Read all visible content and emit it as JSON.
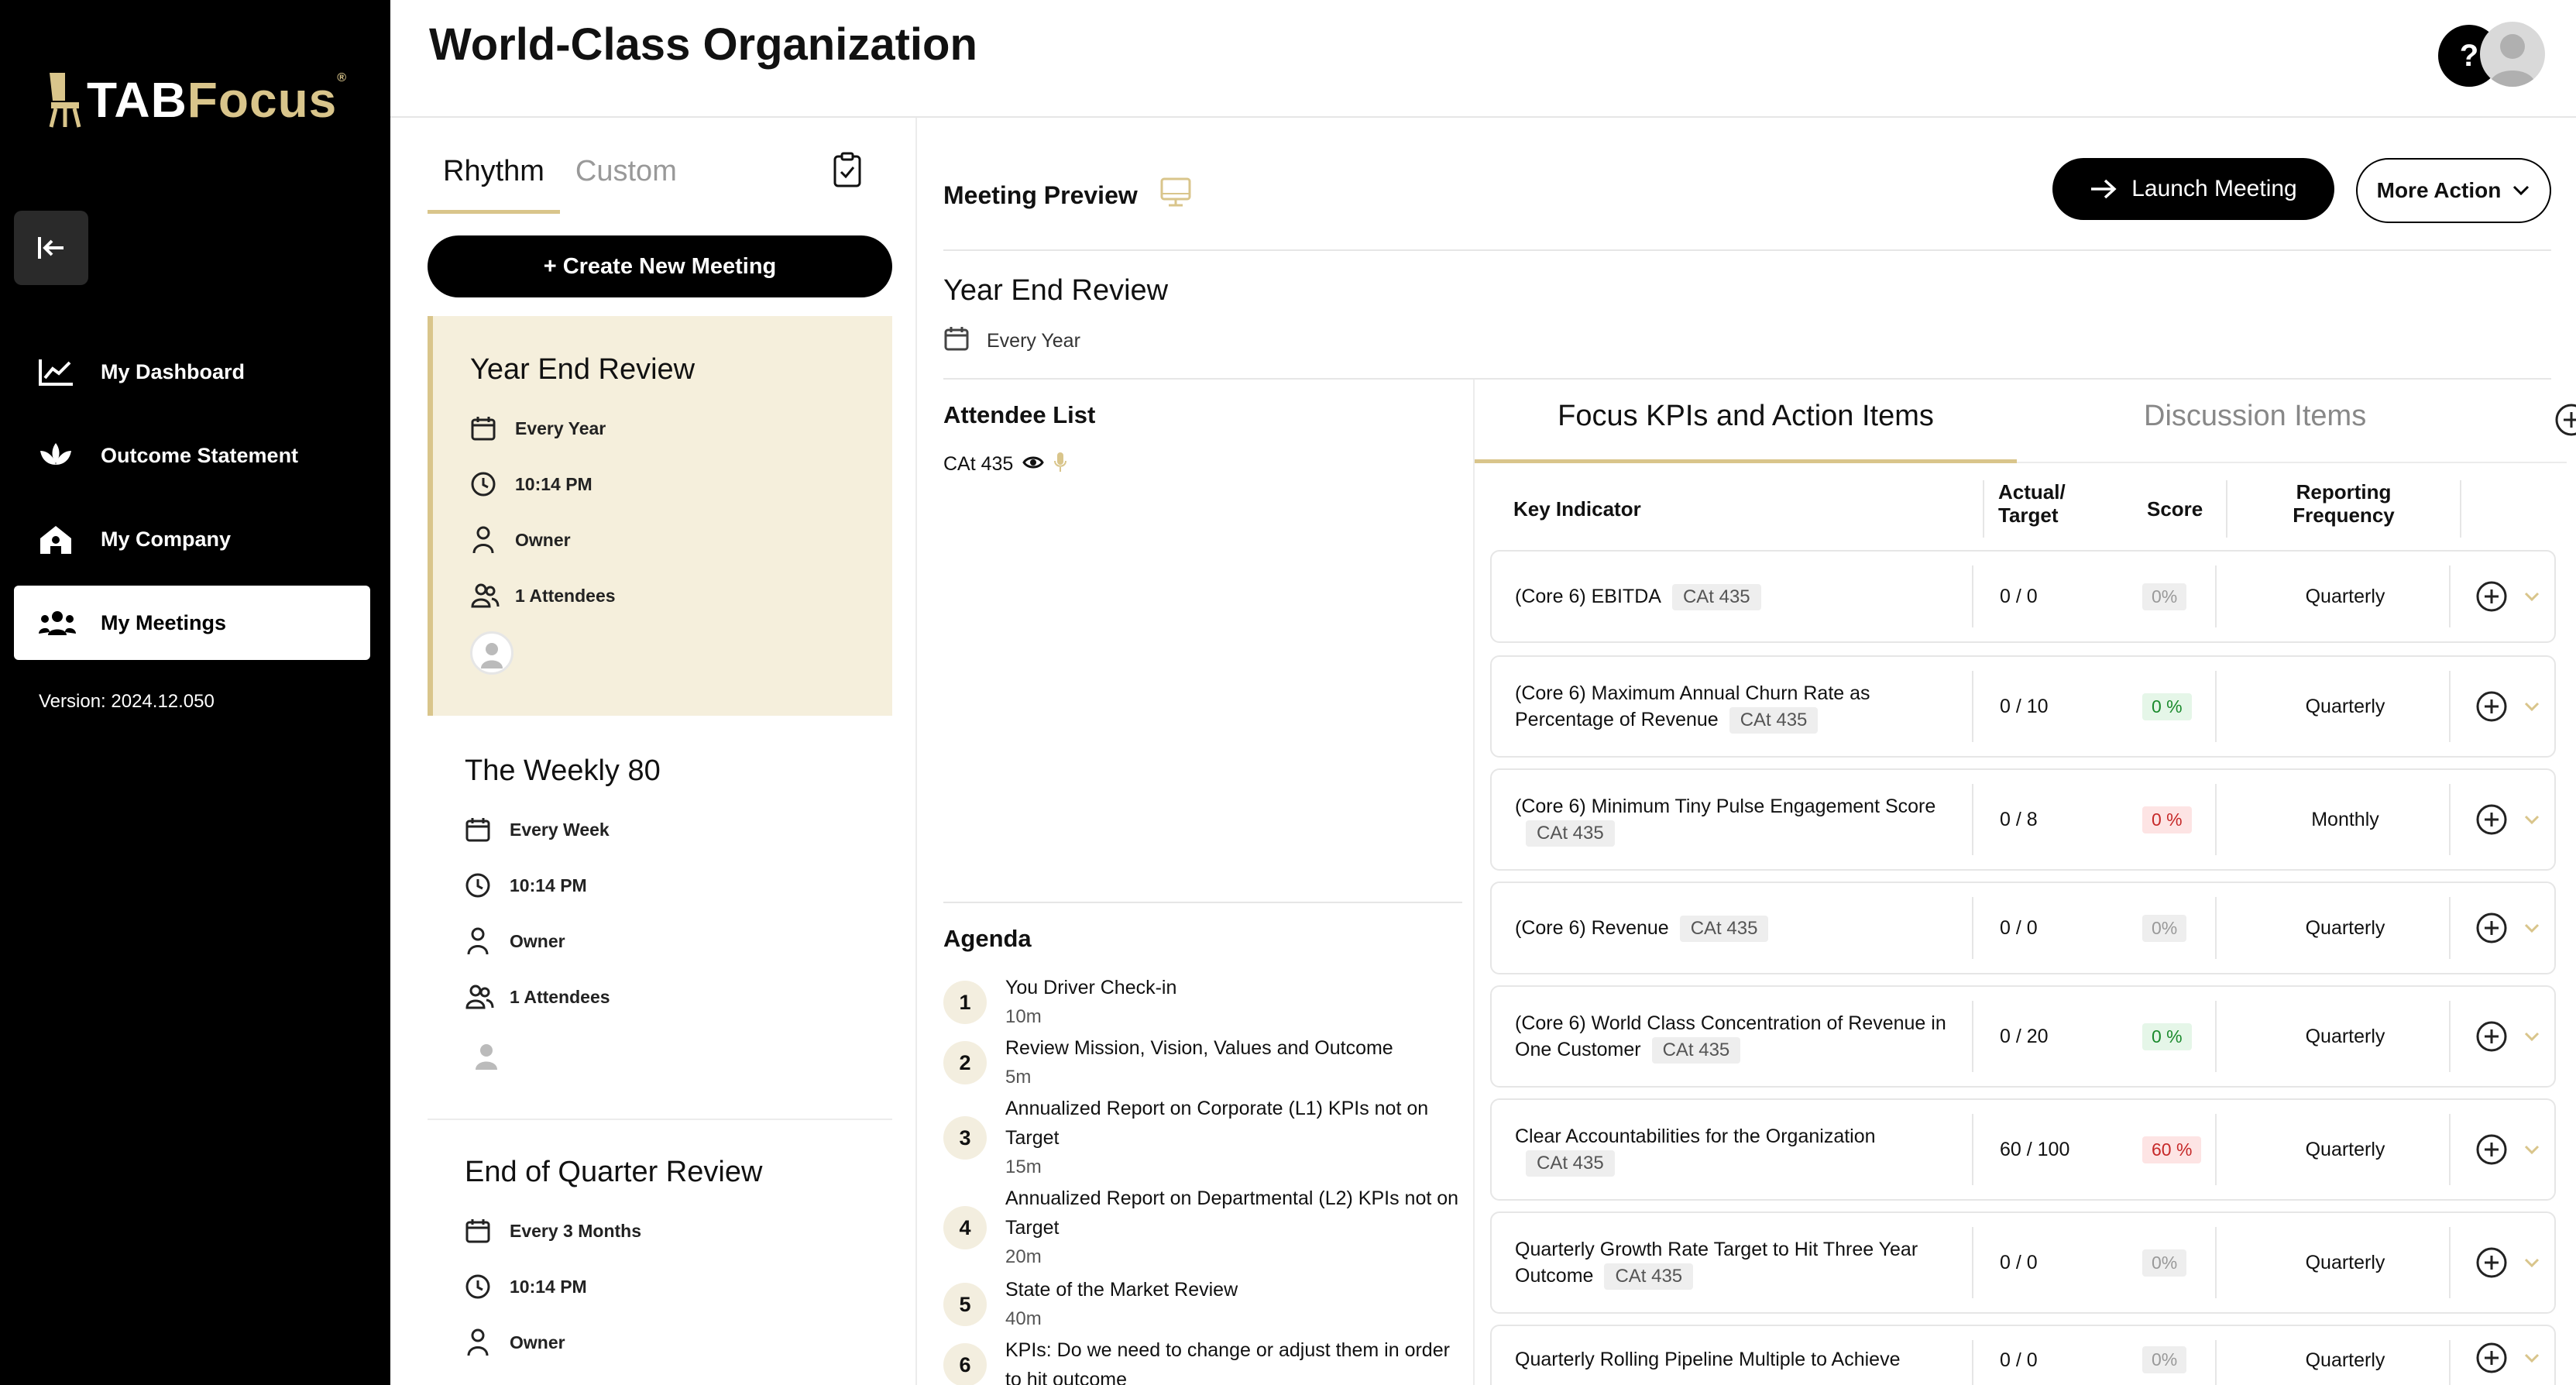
{
  "sidebar": {
    "logo_part1": "TAB",
    "logo_part2": "Focus",
    "logo_mark": "®",
    "items": [
      {
        "label": "My Dashboard",
        "icon": "chart-line-icon"
      },
      {
        "label": "Outcome Statement",
        "icon": "lotus-icon"
      },
      {
        "label": "My Company",
        "icon": "company-house-icon"
      },
      {
        "label": "My Meetings",
        "icon": "users-group-icon",
        "active": true
      }
    ],
    "version": "Version: 2024.12.050"
  },
  "header": {
    "title": "World-Class Organization",
    "help": "?"
  },
  "meetings_panel": {
    "tabs": [
      "Rhythm",
      "Custom"
    ],
    "active_tab": "Rhythm",
    "create_label": "+ Create New Meeting",
    "meetings": [
      {
        "title": "Year End Review",
        "frequency": "Every Year",
        "time": "10:14 PM",
        "owner": "Owner",
        "attendees": "1 Attendees"
      },
      {
        "title": "The Weekly 80",
        "frequency": "Every Week",
        "time": "10:14 PM",
        "owner": "Owner",
        "attendees": "1 Attendees"
      },
      {
        "title": "End of Quarter Review",
        "frequency": "Every 3 Months",
        "time": "10:14 PM",
        "owner": "Owner"
      }
    ]
  },
  "preview": {
    "title": "Meeting Preview",
    "launch_label": "Launch Meeting",
    "more_label": "More Action",
    "meeting_name": "Year End Review",
    "frequency": "Every Year",
    "attendee_title": "Attendee List",
    "attendee": "CAt 435",
    "agenda_title": "Agenda",
    "agenda": [
      {
        "num": "1",
        "text": "You Driver Check-in",
        "dur": "10m"
      },
      {
        "num": "2",
        "text": "Review Mission, Vision, Values and Outcome",
        "dur": "5m"
      },
      {
        "num": "3",
        "text": "Annualized Report on Corporate (L1) KPIs not on Target",
        "dur": "15m"
      },
      {
        "num": "4",
        "text": "Annualized Report on Departmental (L2) KPIs not on Target",
        "dur": "20m"
      },
      {
        "num": "5",
        "text": "State of the Market Review",
        "dur": "40m"
      },
      {
        "num": "6",
        "text": "KPIs: Do we need to change or adjust them in order to hit outcome",
        "dur": ""
      }
    ]
  },
  "kpi": {
    "tab_active": "Focus KPIs and Action Items",
    "tab_other": "Discussion Items",
    "headers": {
      "indicator": "Key Indicator",
      "actual_target": "Actual/ Target",
      "score": "Score",
      "frequency": "Reporting Frequency"
    },
    "rows": [
      {
        "name": "(Core 6) EBITDA",
        "tag": "CAt 435",
        "at": "0 / 0",
        "score": "0%",
        "score_type": "grey",
        "freq": "Quarterly"
      },
      {
        "name": "(Core 6) Maximum Annual Churn Rate as Percentage of Revenue",
        "tag": "CAt 435",
        "at": "0 / 10",
        "score": "0 %",
        "score_type": "green",
        "freq": "Quarterly"
      },
      {
        "name": "(Core 6) Minimum Tiny Pulse Engagement Score",
        "tag": "CAt 435",
        "at": "0 / 8",
        "score": "0 %",
        "score_type": "red",
        "freq": "Monthly"
      },
      {
        "name": "(Core 6) Revenue",
        "tag": "CAt 435",
        "at": "0 / 0",
        "score": "0%",
        "score_type": "grey",
        "freq": "Quarterly"
      },
      {
        "name": "(Core 6) World Class Concentration of Revenue in One Customer",
        "tag": "CAt 435",
        "at": "0 / 20",
        "score": "0 %",
        "score_type": "green",
        "freq": "Quarterly"
      },
      {
        "name": "Clear Accountabilities for the Organization",
        "tag": "CAt 435",
        "at": "60 / 100",
        "score": "60 %",
        "score_type": "red",
        "freq": "Quarterly"
      },
      {
        "name": "Quarterly Growth Rate Target to Hit Three Year Outcome",
        "tag": "CAt 435",
        "at": "0 / 0",
        "score": "0%",
        "score_type": "grey",
        "freq": "Quarterly"
      },
      {
        "name": "Quarterly Rolling Pipeline Multiple to Achieve",
        "tag": "",
        "at": "0 / 0",
        "score": "0%",
        "score_type": "grey",
        "freq": "Quarterly"
      }
    ]
  }
}
